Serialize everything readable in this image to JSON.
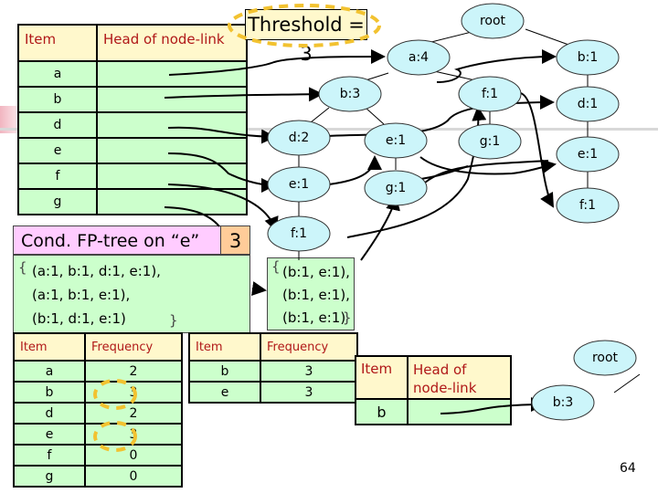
{
  "header_table": {
    "col_item": "Item",
    "col_head": "Head of node-link",
    "items": [
      "a",
      "b",
      "d",
      "e",
      "f",
      "g"
    ]
  },
  "threshold": "Threshold = 3",
  "tree": {
    "nodes": {
      "root": "root",
      "a4": "a:4",
      "b1_top": "b:1",
      "b3": "b:3",
      "f1_mid": "f:1",
      "d1_right": "d:1",
      "d2": "d:2",
      "e1_mid": "e:1",
      "g1_mid": "g:1",
      "e1_right": "e:1",
      "e1_left": "e:1",
      "g1_low": "g:1",
      "f1_right": "f:1",
      "f1_low": "f:1"
    }
  },
  "cond_tree": {
    "title": "Cond. FP-tree on “e”",
    "count": "3",
    "open_brace": "{",
    "close_brace": "}",
    "lines": [
      "(a:1, b:1, d:1, e:1),",
      "(a:1, b:1, e:1),",
      "(b:1, d:1, e:1)"
    ]
  },
  "filtered": {
    "open_brace": "{",
    "close_brace": "}",
    "lines": [
      "(b:1, e:1),",
      "(b:1, e:1),",
      "(b:1, e:1)"
    ]
  },
  "freq_table": {
    "col_item": "Item",
    "col_freq": "Frequency",
    "rows": [
      {
        "item": "a",
        "freq": "2"
      },
      {
        "item": "b",
        "freq": "3"
      },
      {
        "item": "d",
        "freq": "2"
      },
      {
        "item": "e",
        "freq": "3"
      },
      {
        "item": "f",
        "freq": "0"
      },
      {
        "item": "g",
        "freq": "0"
      }
    ]
  },
  "freq_table_filtered": {
    "col_item": "Item",
    "col_freq": "Frequency",
    "rows": [
      {
        "item": "b",
        "freq": "3"
      },
      {
        "item": "e",
        "freq": "3"
      }
    ]
  },
  "result_table": {
    "col_item": "Item",
    "col_head": "Head of node-link",
    "items": [
      "b"
    ]
  },
  "result_tree": {
    "root": "root",
    "b3": "b:3"
  },
  "page_number": "64",
  "colors": {
    "node_fill": "#ccf5fa",
    "header_fill": "#fff8cc",
    "cell_fill": "#ccffcc",
    "header_text": "#b01818",
    "highlight": "#f2c230",
    "cond_title_fill": "#ffccff",
    "cond_count_fill": "#ffcc99"
  }
}
